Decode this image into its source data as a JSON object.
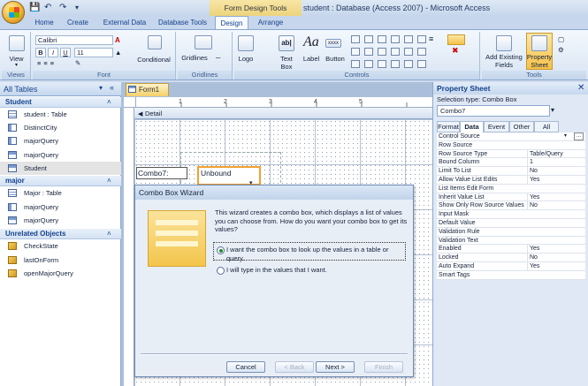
{
  "window": {
    "context_tab": "Form Design Tools",
    "title": "student : Database (Access 2007) - Microsoft Access"
  },
  "tabs": [
    "Home",
    "Create",
    "External Data",
    "Database Tools",
    "Design",
    "Arrange"
  ],
  "active_tab": "Design",
  "ribbon": {
    "views": {
      "view_label": "View",
      "group": "Views"
    },
    "font": {
      "family": "Calibri",
      "size": "11",
      "group": "Font"
    },
    "conditional": "Conditional",
    "gridlines": {
      "label": "Gridlines",
      "group": "Gridlines"
    },
    "controls": {
      "logo": "Logo",
      "text_box": "Text\nBox",
      "label": "Label",
      "button": "Button",
      "group": "Controls"
    },
    "tools": {
      "add_fields": "Add Existing\nFields",
      "property_sheet": "Property\nSheet",
      "group": "Tools"
    }
  },
  "nav": {
    "header": "All Tables",
    "groups": [
      {
        "name": "Student",
        "items": [
          {
            "label": "student : Table",
            "icon": "table"
          },
          {
            "label": "DistinctCity",
            "icon": "query"
          },
          {
            "label": "majorQuery",
            "icon": "query"
          },
          {
            "label": "majorQuery",
            "icon": "form"
          },
          {
            "label": "Student",
            "icon": "form",
            "selected": true
          }
        ]
      },
      {
        "name": "major",
        "items": [
          {
            "label": "Major : Table",
            "icon": "table"
          },
          {
            "label": "majorQuery",
            "icon": "query"
          },
          {
            "label": "majorQuery",
            "icon": "form"
          }
        ]
      },
      {
        "name": "Unrelated Objects",
        "items": [
          {
            "label": "CheckState",
            "icon": "macro"
          },
          {
            "label": "lastOnForm",
            "icon": "macro"
          },
          {
            "label": "openMajorQuery",
            "icon": "macro"
          }
        ]
      }
    ]
  },
  "form": {
    "tab": "Form1",
    "detail": "Detail",
    "combo_label": "Combo7:",
    "combo_value": "Unbound"
  },
  "wizard": {
    "title": "Combo Box Wizard",
    "description": "This wizard creates a combo box, which displays a list of values you can choose from.  How do you want your combo box to get its values?",
    "option1": "I want the combo box to look up the values in a table or query.",
    "option2": "I will type in the values that I want.",
    "buttons": {
      "cancel": "Cancel",
      "back": "< Back",
      "next": "Next >",
      "finish": "Finish"
    }
  },
  "property_sheet": {
    "title": "Property Sheet",
    "selection_type": "Selection type:  Combo Box",
    "selected": "Combo7",
    "tabs": [
      "Format",
      "Data",
      "Event",
      "Other",
      "All"
    ],
    "active_tab": "Data",
    "rows": [
      {
        "name": "Control Source",
        "value": ""
      },
      {
        "name": "Row Source",
        "value": ""
      },
      {
        "name": "Row Source Type",
        "value": "Table/Query"
      },
      {
        "name": "Bound Column",
        "value": "1"
      },
      {
        "name": "Limit To List",
        "value": "No"
      },
      {
        "name": "Allow Value List Edits",
        "value": "Yes"
      },
      {
        "name": "List Items Edit Form",
        "value": ""
      },
      {
        "name": "Inherit Value List",
        "value": "Yes"
      },
      {
        "name": "Show Only Row Source Values",
        "value": "No"
      },
      {
        "name": "Input Mask",
        "value": ""
      },
      {
        "name": "Default Value",
        "value": ""
      },
      {
        "name": "Validation Rule",
        "value": ""
      },
      {
        "name": "Validation Text",
        "value": ""
      },
      {
        "name": "Enabled",
        "value": "Yes"
      },
      {
        "name": "Locked",
        "value": "No"
      },
      {
        "name": "Auto Expand",
        "value": "Yes"
      },
      {
        "name": "Smart Tags",
        "value": ""
      }
    ]
  }
}
